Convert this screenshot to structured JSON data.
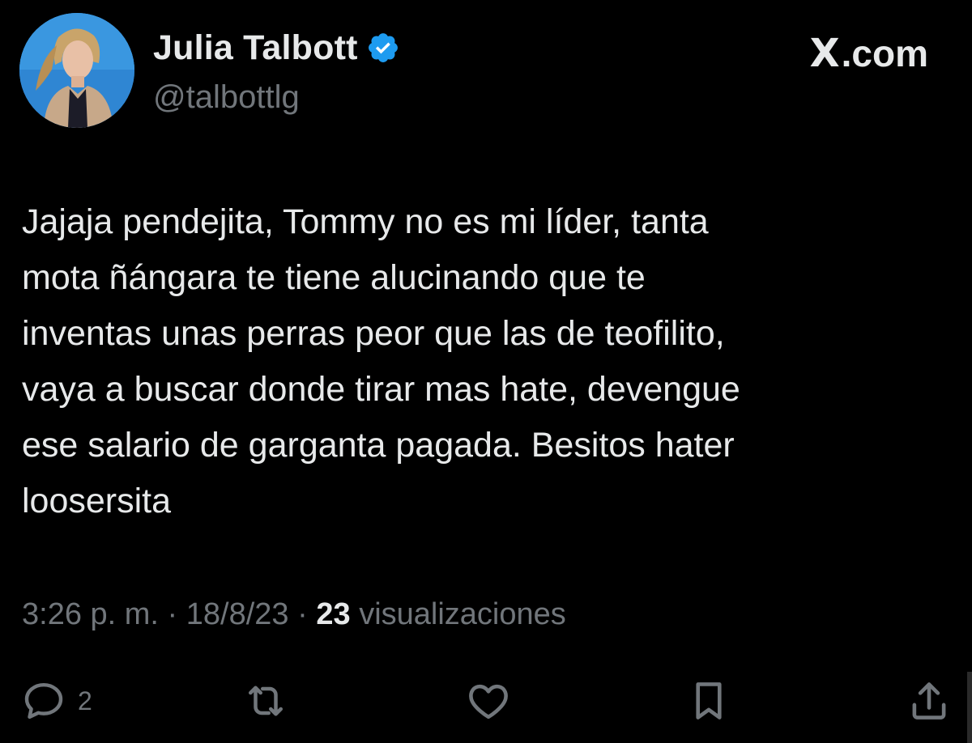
{
  "author": {
    "display_name": "Julia Talbott",
    "handle": "@talbottlg",
    "avatar_alt": "profile photo",
    "verified_icon": "verified-badge-icon"
  },
  "brand": {
    "label": ".com",
    "logo": "X"
  },
  "tweet": {
    "lines": [
      "Jajaja pendejita, Tommy no es mi líder, tanta",
      "mota ñángara te tiene alucinando que te",
      "inventas unas perras peor que las de teofilito,",
      "vaya a buscar donde tirar mas hate, devengue",
      "ese salario de garganta pagada. Besitos hater",
      "loosersita"
    ]
  },
  "meta": {
    "time": "3:26 p. m.",
    "separator": "·",
    "date": "18/8/23",
    "views_count": "23",
    "views_label": "visualizaciones"
  },
  "actions": {
    "reply_count": "2",
    "icons": [
      "reply-icon",
      "retweet-icon",
      "like-icon",
      "bookmark-icon",
      "share-icon"
    ]
  },
  "colors": {
    "background": "#000000",
    "text_primary": "#e7e9ea",
    "text_secondary": "#71767b",
    "verified_blue": "#1d9bf0"
  }
}
